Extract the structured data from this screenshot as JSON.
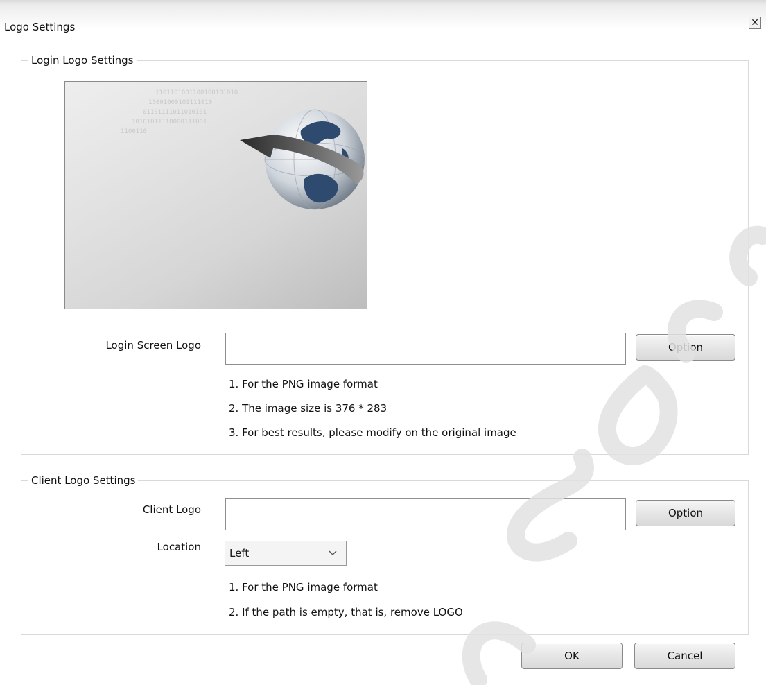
{
  "dialog": {
    "title": "Logo Settings",
    "close_icon": "close-icon"
  },
  "login_group": {
    "legend": "Login Logo Settings",
    "preview_binary": [
      "1101101001100100101010",
      "10001000101111010",
      "01101111011010101",
      "10101011110000111001",
      "1100110"
    ],
    "logo_label": "Login Screen Logo",
    "logo_value": "",
    "option_label": "Option",
    "notes": [
      "1. For the PNG image format",
      "2. The image size is 376 * 283",
      "3. For best results, please modify on the original image"
    ]
  },
  "client_group": {
    "legend": "Client Logo Settings",
    "logo_label": "Client Logo",
    "logo_value": "",
    "option_label": "Option",
    "location_label": "Location",
    "location_value": "Left",
    "notes": [
      "1. For the PNG image format",
      "2. If the path is empty, that is, remove LOGO"
    ]
  },
  "buttons": {
    "ok": "OK",
    "cancel": "Cancel"
  },
  "colors": {
    "watermark": "#e0e0e0",
    "globe_land": "#2e4a6e"
  }
}
